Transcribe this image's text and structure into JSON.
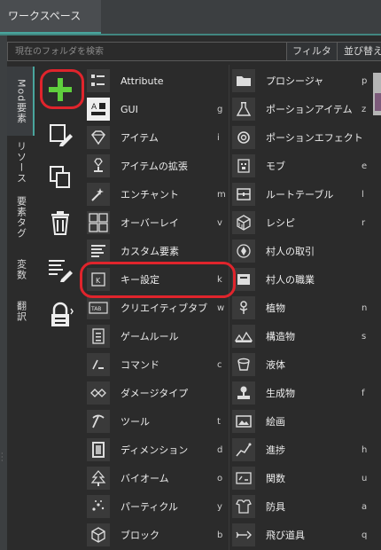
{
  "header": {
    "tab_title": "ワークスペース"
  },
  "search": {
    "placeholder": "現在のフォルダを検索",
    "filter_label": "フィルタ",
    "sort_label": "並び替え"
  },
  "sidebar_tabs": [
    {
      "label": "Mod要素",
      "active": true
    },
    {
      "label": "リソース"
    },
    {
      "label": "要素タグ"
    },
    {
      "label": "変数"
    },
    {
      "label": "翻訳"
    }
  ],
  "actions": [
    {
      "icon": "add-icon"
    },
    {
      "icon": "new-file-icon"
    },
    {
      "icon": "duplicate-icon"
    },
    {
      "icon": "trash-icon"
    },
    {
      "icon": "list-edit-icon"
    },
    {
      "icon": "lock-icon"
    }
  ],
  "elements_left": [
    {
      "label": "Attribute",
      "key": ""
    },
    {
      "label": "GUI",
      "key": "g"
    },
    {
      "label": "アイテム",
      "key": "i"
    },
    {
      "label": "アイテムの拡張",
      "key": ""
    },
    {
      "label": "エンチャント",
      "key": "m"
    },
    {
      "label": "オーバーレイ",
      "key": "v"
    },
    {
      "label": "カスタム要素",
      "key": ""
    },
    {
      "label": "キー設定",
      "key": "k"
    },
    {
      "label": "クリエイティブタブ",
      "key": "w"
    },
    {
      "label": "ゲームルール",
      "key": ""
    },
    {
      "label": "コマンド",
      "key": "c"
    },
    {
      "label": "ダメージタイプ",
      "key": ""
    },
    {
      "label": "ツール",
      "key": "t"
    },
    {
      "label": "ディメンション",
      "key": "d"
    },
    {
      "label": "バイオーム",
      "key": "o"
    },
    {
      "label": "パーティクル",
      "key": "y"
    },
    {
      "label": "ブロック",
      "key": "b"
    }
  ],
  "elements_right": [
    {
      "label": "プロシージャ",
      "key": "p"
    },
    {
      "label": "ポーションアイテム",
      "key": "z"
    },
    {
      "label": "ポーションエフェクト",
      "key": ""
    },
    {
      "label": "モブ",
      "key": "e"
    },
    {
      "label": "ルートテーブル",
      "key": "l"
    },
    {
      "label": "レシピ",
      "key": "r"
    },
    {
      "label": "村人の取引",
      "key": ""
    },
    {
      "label": "村人の職業",
      "key": ""
    },
    {
      "label": "植物",
      "key": "n"
    },
    {
      "label": "構造物",
      "key": "s"
    },
    {
      "label": "液体",
      "key": ""
    },
    {
      "label": "生成物",
      "key": "f"
    },
    {
      "label": "絵画",
      "key": ""
    },
    {
      "label": "進捗",
      "key": "h"
    },
    {
      "label": "関数",
      "key": "u"
    },
    {
      "label": "防具",
      "key": "a"
    },
    {
      "label": "飛び道具",
      "key": "q"
    }
  ],
  "colors": {
    "accent": "#49a59d",
    "highlight_ring": "#e0242c",
    "add_green": "#5fcf3d"
  },
  "highlighted": [
    "add-button",
    "element-key-settings"
  ]
}
